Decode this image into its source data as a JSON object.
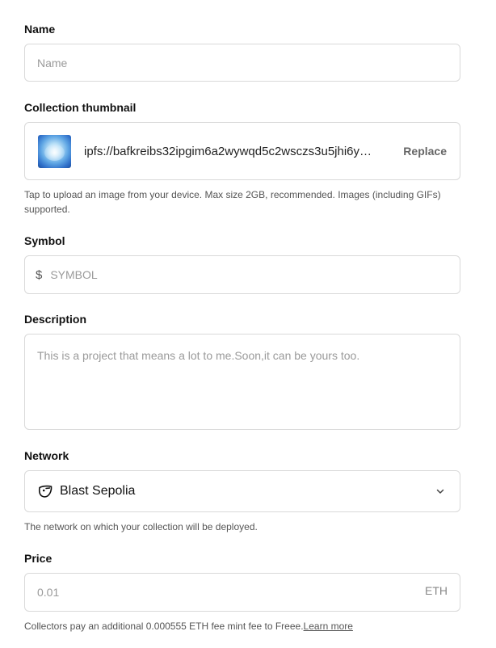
{
  "name": {
    "label": "Name",
    "placeholder": "Name",
    "value": ""
  },
  "thumbnail": {
    "label": "Collection thumbnail",
    "ipfs_uri": "ipfs://bafkreibs32ipgim6a2wywqd5c2wsczs3u5jhi6y…",
    "replace_label": "Replace",
    "helper": "Tap to upload an image from your device. Max size 2GB, recommended. Images (including GIFs) supported."
  },
  "symbol": {
    "label": "Symbol",
    "prefix": "$",
    "placeholder": "SYMBOL",
    "value": ""
  },
  "description": {
    "label": "Description",
    "placeholder": "This is a project that means a lot to me.Soon,it can be yours too.",
    "value": ""
  },
  "network": {
    "label": "Network",
    "selected": "Blast Sepolia",
    "icon": "blast-bird-icon",
    "helper": "The network on which your collection will be deployed."
  },
  "price": {
    "label": "Price",
    "placeholder": "0.01",
    "value": "",
    "unit": "ETH",
    "helper_text": "Collectors pay an additional 0.000555 ETH fee mint fee to Freee.",
    "helper_link": "Learn more"
  }
}
